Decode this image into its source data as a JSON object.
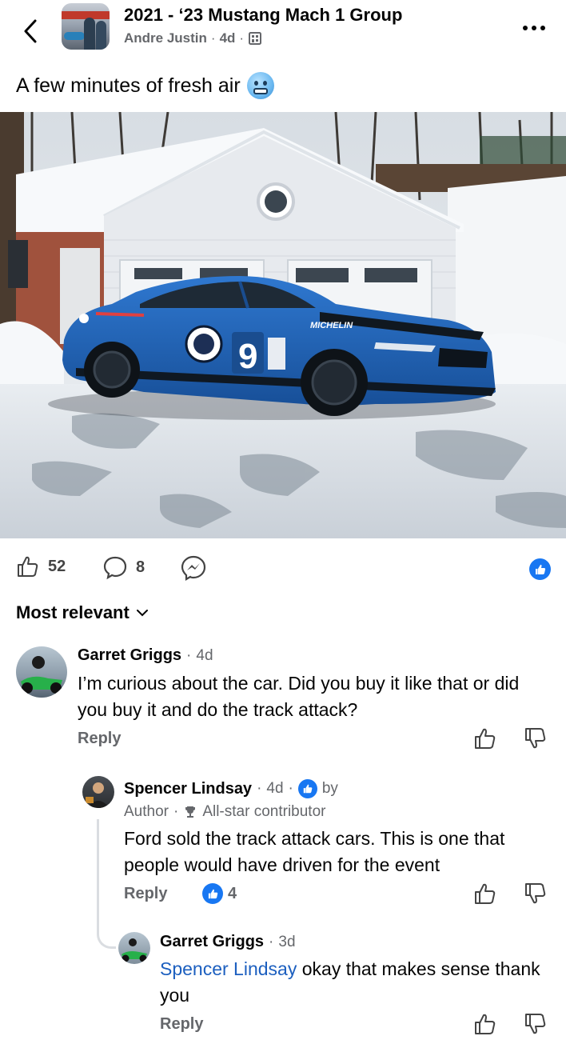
{
  "header": {
    "group_name": "2021 - ‘23 Mustang Mach 1 Group",
    "author": "Andre Justin",
    "time": "4d",
    "separator": "·"
  },
  "post": {
    "text": "A few minutes of fresh air",
    "emoji": "cold-face-emoji",
    "photo_car_brand": "MICHELIN",
    "photo_car_number": "9"
  },
  "actions": {
    "likes": "52",
    "comments": "8"
  },
  "sort": {
    "label": "Most relevant"
  },
  "comments": [
    {
      "name": "Garret Griggs",
      "time": "4d",
      "text": "I’m curious about the car. Did you buy it like that or did you buy it and do the track attack?",
      "reply_label": "Reply"
    },
    {
      "name": "Spencer Lindsay",
      "time": "4d",
      "by_label": "by",
      "badge_author": "Author",
      "badge_allstar": "All-star contributor",
      "text": "Ford sold the track attack cars. This is one that people would have driven for the event",
      "reply_label": "Reply",
      "reaction_count": "4"
    },
    {
      "name": "Garret Griggs",
      "time": "3d",
      "mention": "Spencer Lindsay",
      "text": " okay that makes sense thank you",
      "reply_label": "Reply"
    }
  ],
  "colors": {
    "accent_blue": "#1877f2",
    "mention_blue": "#1c5fbf",
    "secondary_text": "#65676b",
    "car_blue": "#1f5fb5"
  }
}
